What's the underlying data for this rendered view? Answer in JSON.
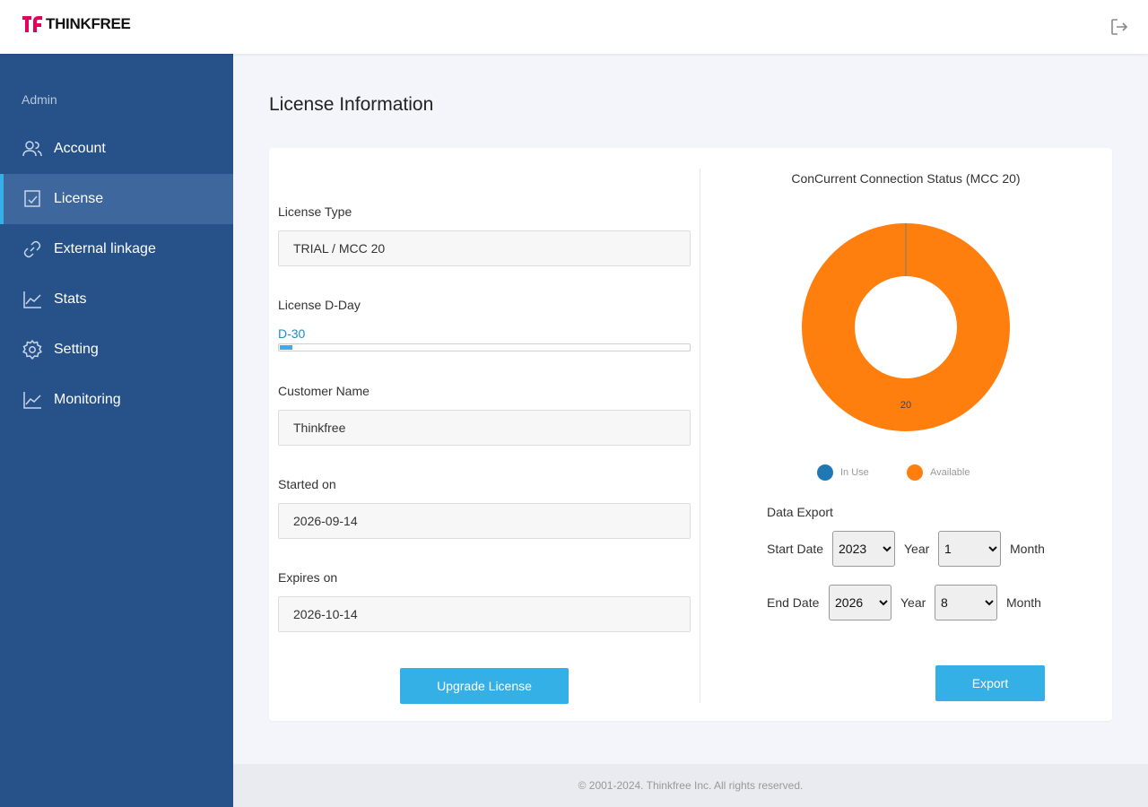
{
  "brand": {
    "name": "THINKFREE",
    "logo_colors": [
      "#e6005c",
      "#111111"
    ]
  },
  "header": {
    "logout_icon": "logout-icon"
  },
  "sidebar": {
    "section_label": "Admin",
    "items": [
      {
        "label": "Account",
        "icon": "users-icon",
        "active": false
      },
      {
        "label": "License",
        "icon": "license-icon",
        "active": true
      },
      {
        "label": "External linkage",
        "icon": "link-icon",
        "active": false
      },
      {
        "label": "Stats",
        "icon": "line-chart-icon",
        "active": false
      },
      {
        "label": "Setting",
        "icon": "gear-icon",
        "active": false
      },
      {
        "label": "Monitoring",
        "icon": "line-chart-icon",
        "active": false
      }
    ]
  },
  "page": {
    "title": "License Information"
  },
  "license": {
    "type_label": "License Type",
    "type_value": "TRIAL / MCC 20",
    "dday_label": "License D-Day",
    "dday_value": "D-30",
    "dday_progress": 0.03,
    "customer_label": "Customer Name",
    "customer_value": "Thinkfree",
    "started_label": "Started on",
    "started_value": "2026-09-14",
    "expires_label": "Expires on",
    "expires_value": "2026-10-14",
    "upgrade_button": "Upgrade License"
  },
  "chart_data": {
    "type": "pie",
    "title": "ConCurrent Connection Status (MCC 20)",
    "categories": [
      "In Use",
      "Available"
    ],
    "values": [
      0,
      20
    ],
    "colors": [
      "#1f77b4",
      "#ff7f0e"
    ],
    "data_labels": [
      "",
      "20"
    ],
    "legend": "bottom"
  },
  "export": {
    "title": "Data Export",
    "start_label": "Start Date",
    "end_label": "End Date",
    "year_label": "Year",
    "month_label": "Month",
    "start_year": "2023",
    "start_month": "1",
    "end_year": "2026",
    "end_month": "8",
    "button": "Export"
  },
  "footer": {
    "text": "© 2001-2024. Thinkfree Inc. All rights reserved."
  },
  "colors": {
    "sidebar_bg": "#265189",
    "sidebar_active": "#3d679d",
    "accent": "#35b0e6"
  }
}
